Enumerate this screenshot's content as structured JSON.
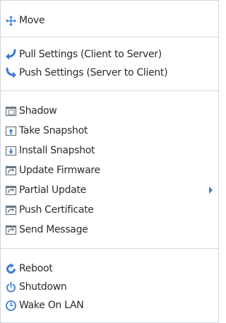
{
  "colors": {
    "accent_blue": "#3a7bd5",
    "icon_gray": "#6b7683",
    "separator": "#d4d9df",
    "text": "#2b2b2b"
  },
  "menu": {
    "move": {
      "label": "Move",
      "icon": "move-icon"
    },
    "pull_settings": {
      "label": "Pull Settings (Client to Server)",
      "icon": "pull-arrow-icon"
    },
    "push_settings": {
      "label": "Push Settings (Server to Client)",
      "icon": "push-arrow-icon"
    },
    "shadow": {
      "label": "Shadow",
      "icon": "shadow-icon"
    },
    "take_snapshot": {
      "label": "Take Snapshot",
      "icon": "take-snapshot-icon"
    },
    "install_snapshot": {
      "label": "Install Snapshot",
      "icon": "install-snapshot-icon"
    },
    "update_firmware": {
      "label": "Update Firmware",
      "icon": "update-firmware-icon"
    },
    "partial_update": {
      "label": "Partial Update",
      "icon": "partial-update-icon",
      "submenu_icon": "submenu-arrow-icon"
    },
    "push_certificate": {
      "label": "Push Certificate",
      "icon": "push-certificate-icon"
    },
    "send_message": {
      "label": "Send Message",
      "icon": "send-message-icon"
    },
    "reboot": {
      "label": "Reboot",
      "icon": "reboot-icon"
    },
    "shutdown": {
      "label": "Shutdown",
      "icon": "shutdown-icon"
    },
    "wake_on_lan": {
      "label": "Wake On LAN",
      "icon": "wake-on-lan-icon"
    }
  }
}
